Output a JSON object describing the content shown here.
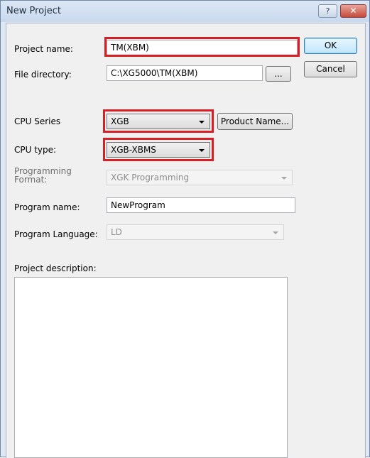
{
  "window": {
    "title": "New Project",
    "help_label": "?",
    "close_label": "✕"
  },
  "form": {
    "project_name_label": "Project name:",
    "project_name_value": "TM(XBM)",
    "file_directory_label": "File directory:",
    "file_directory_value": "C:\\XG5000\\TM(XBM)",
    "browse_label": "...",
    "cpu_series_label": "CPU Series",
    "cpu_series_value": "XGB",
    "product_name_label": "Product Name...",
    "cpu_type_label": "CPU type:",
    "cpu_type_value": "XGB-XBMS",
    "programming_format_label_line1": "Programming",
    "programming_format_label_line2": "Format:",
    "programming_format_value": "XGK Programming",
    "program_name_label": "Program name:",
    "program_name_value": "NewProgram",
    "program_language_label": "Program Language:",
    "program_language_value": "LD",
    "project_description_label": "Project description:",
    "project_description_value": ""
  },
  "buttons": {
    "ok_label": "OK",
    "cancel_label": "Cancel"
  },
  "colors": {
    "highlight": "#d81f26"
  }
}
